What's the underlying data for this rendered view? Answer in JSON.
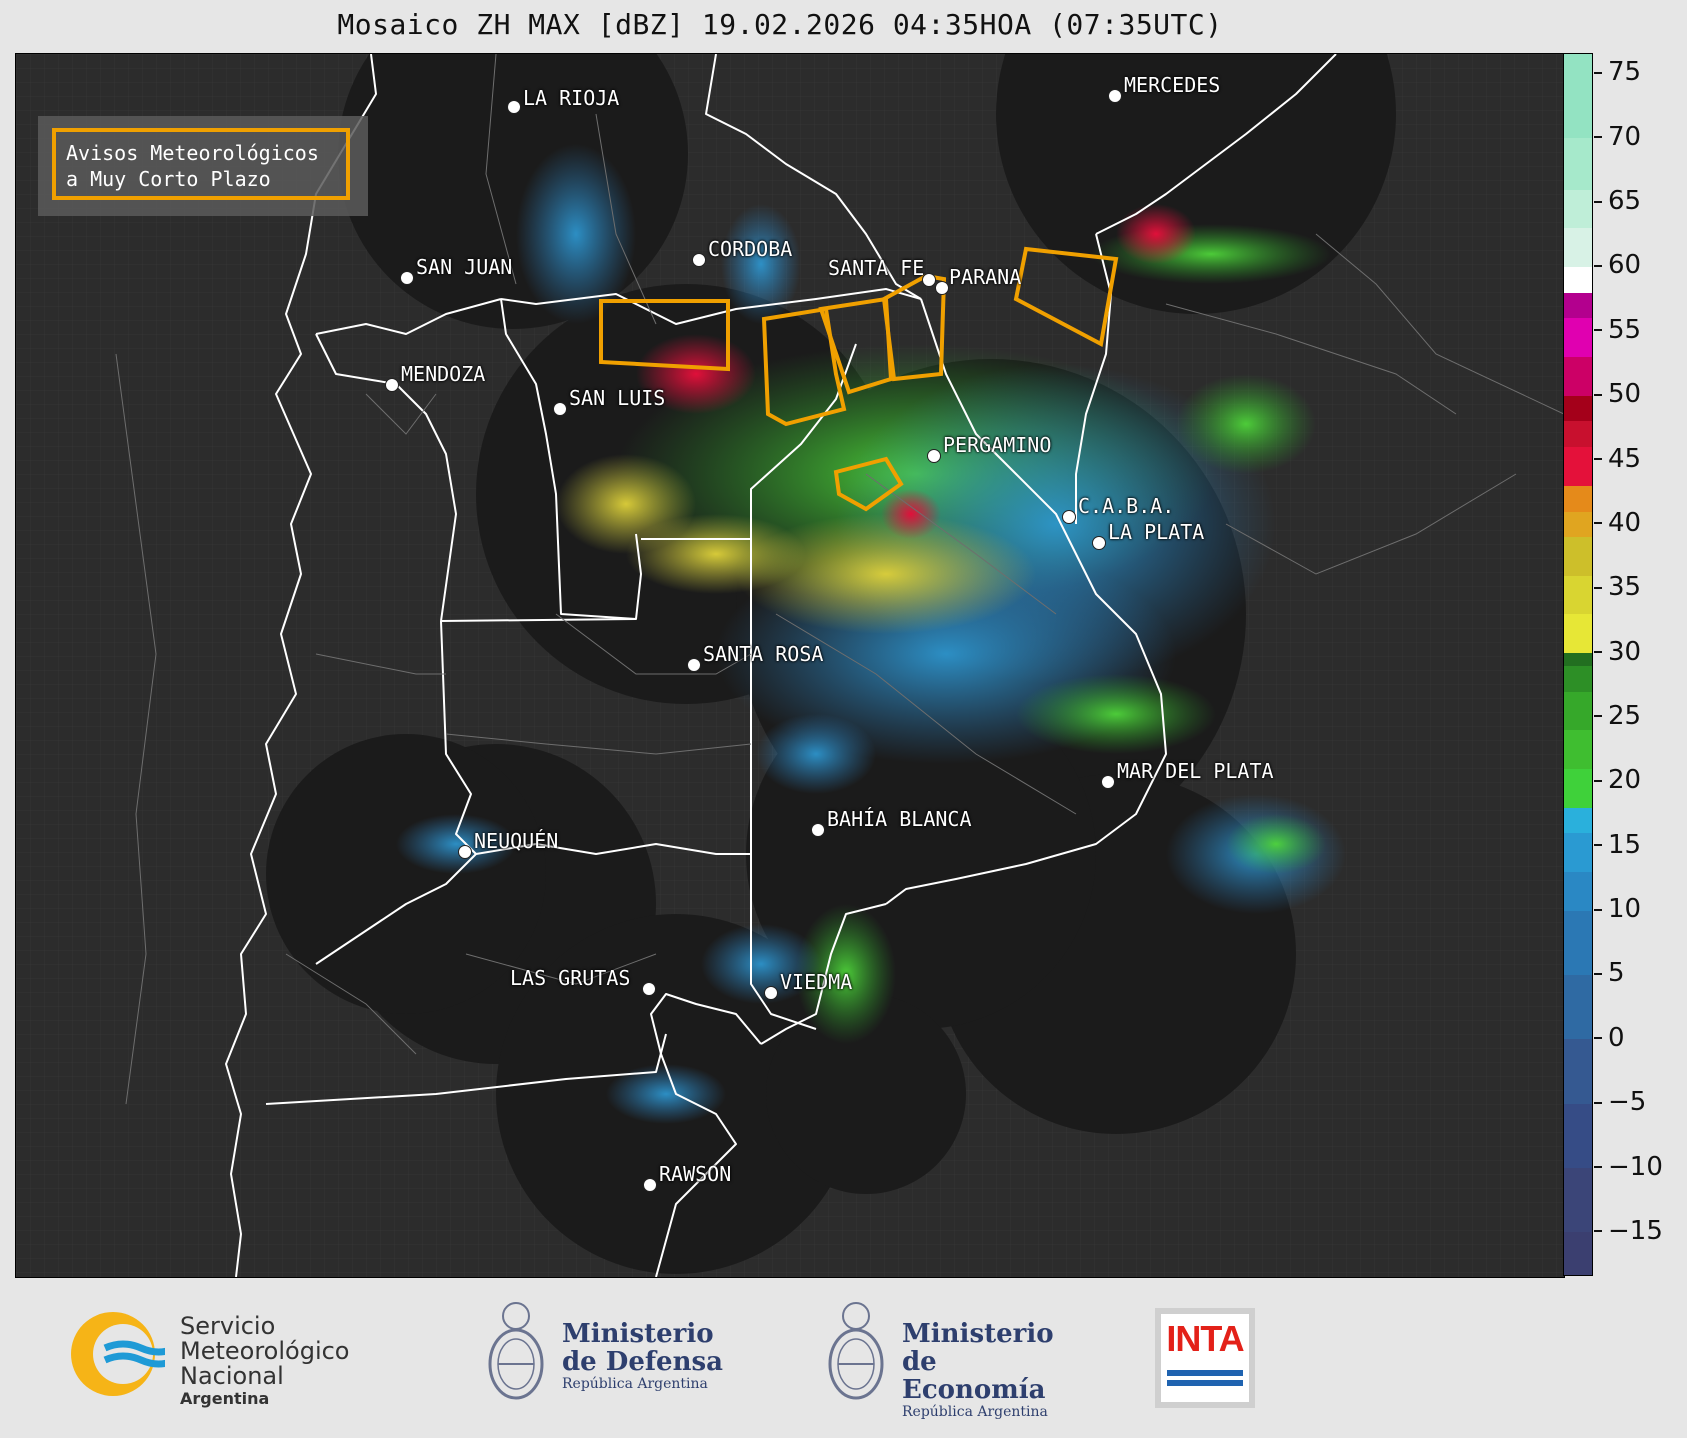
{
  "title": "Mosaico ZH MAX [dBZ] 19.02.2026 04:35HOA (07:35UTC)",
  "warning_box": {
    "line1": "Avisos Meteorológicos",
    "line2": "a Muy Corto Plazo",
    "color": "#f0a000"
  },
  "cities": [
    {
      "name": "LA RIOJA"
    },
    {
      "name": "MERCEDES"
    },
    {
      "name": "SAN JUAN"
    },
    {
      "name": "CORDOBA"
    },
    {
      "name": "SANTA FE"
    },
    {
      "name": "PARANA"
    },
    {
      "name": "MENDOZA"
    },
    {
      "name": "SAN LUIS"
    },
    {
      "name": "PERGAMINO"
    },
    {
      "name": "C.A.B.A."
    },
    {
      "name": "LA PLATA"
    },
    {
      "name": "SANTA ROSA"
    },
    {
      "name": "MAR DEL PLATA"
    },
    {
      "name": "BAHÍA BLANCA"
    },
    {
      "name": "NEUQUÉN"
    },
    {
      "name": "LAS GRUTAS"
    },
    {
      "name": "VIEDMA"
    },
    {
      "name": "RAWSON"
    }
  ],
  "colorbar": {
    "unit": "dBZ",
    "ticks": [
      "75",
      "70",
      "65",
      "60",
      "55",
      "50",
      "45",
      "40",
      "35",
      "30",
      "25",
      "20",
      "15",
      "10",
      "5",
      "0",
      "−5",
      "−10",
      "−15"
    ],
    "range": [
      -18.5,
      76.5
    ]
  },
  "logos": {
    "smn_line1": "Servicio",
    "smn_line2": "Meteorológico",
    "smn_line3": "Nacional",
    "smn_sub": "Argentina",
    "defensa_line1": "Ministerio",
    "defensa_line2": "de Defensa",
    "defensa_sub": "República Argentina",
    "economia_line1": "Ministerio",
    "economia_line2": "de Economía",
    "economia_sub": "República Argentina",
    "inta": "INTA"
  },
  "colors": {
    "map_background": "#2c2c2c",
    "radar_coverage": "#1b1b1b",
    "border": "#ffffff",
    "warning": "#f0a000"
  }
}
